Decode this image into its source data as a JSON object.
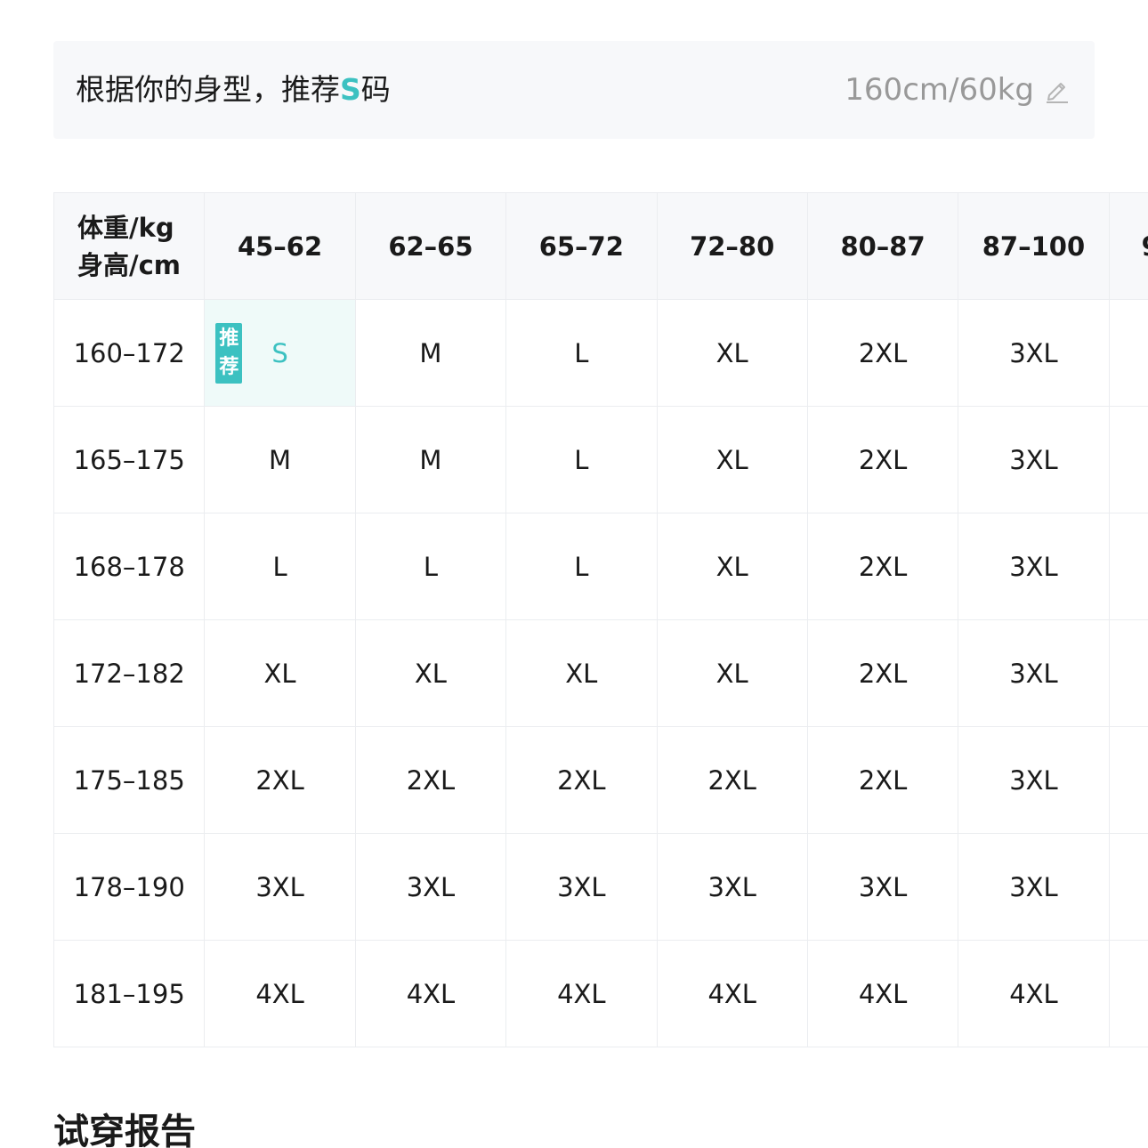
{
  "banner": {
    "text_prefix": "根据你的身型，推荐",
    "recommended_size": "S",
    "text_suffix": "码",
    "measurements": "160cm/60kg",
    "edit_icon": "edit-pencil-icon"
  },
  "table": {
    "corner": {
      "weight_label": "体重/kg",
      "height_label": "身高/cm"
    },
    "weight_ranges": [
      "45–62",
      "62–65",
      "65–72",
      "72–80",
      "80–87",
      "87–100",
      "9"
    ],
    "rows": [
      {
        "height": "160–172",
        "sizes": [
          "S",
          "M",
          "L",
          "XL",
          "2XL",
          "3XL",
          ""
        ]
      },
      {
        "height": "165–175",
        "sizes": [
          "M",
          "M",
          "L",
          "XL",
          "2XL",
          "3XL",
          ""
        ]
      },
      {
        "height": "168–178",
        "sizes": [
          "L",
          "L",
          "L",
          "XL",
          "2XL",
          "3XL",
          ""
        ]
      },
      {
        "height": "172–182",
        "sizes": [
          "XL",
          "XL",
          "XL",
          "XL",
          "2XL",
          "3XL",
          ""
        ]
      },
      {
        "height": "175–185",
        "sizes": [
          "2XL",
          "2XL",
          "2XL",
          "2XL",
          "2XL",
          "3XL",
          ""
        ]
      },
      {
        "height": "178–190",
        "sizes": [
          "3XL",
          "3XL",
          "3XL",
          "3XL",
          "3XL",
          "3XL",
          ""
        ]
      },
      {
        "height": "181–195",
        "sizes": [
          "4XL",
          "4XL",
          "4XL",
          "4XL",
          "4XL",
          "4XL",
          ""
        ]
      }
    ],
    "recommended_badge": [
      "推",
      "荐"
    ],
    "recommended_cell": {
      "row": 0,
      "col": 0
    }
  },
  "section": {
    "title": "试穿报告"
  },
  "colors": {
    "accent": "#3cc1c1",
    "banner_bg": "#f7f8fa",
    "highlight_bg": "#effaf9",
    "muted_text": "#999999"
  }
}
